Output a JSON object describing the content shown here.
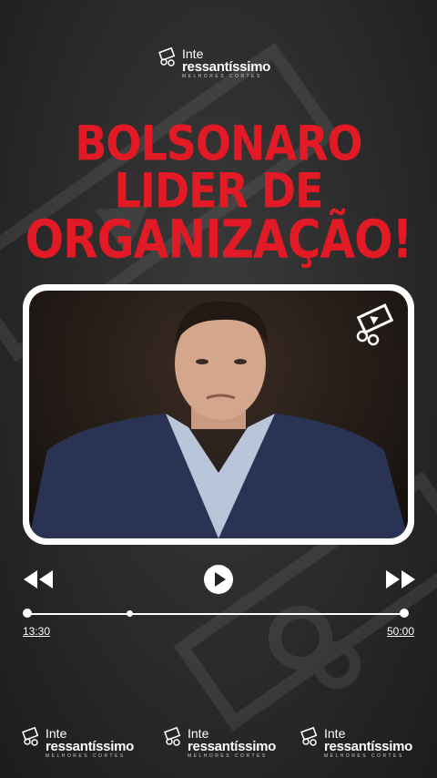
{
  "brand": {
    "line1": "Inte",
    "line2": "ressantíssimo",
    "tagline": "MELHORES CORTES"
  },
  "headline": {
    "line1": "BOLSONARO",
    "line2": "LIDER DE",
    "line3": "ORGANIZAÇÃO!"
  },
  "player": {
    "current_time": "13:30",
    "total_time": "50:00",
    "progress": 0.27
  },
  "icons": {
    "rewind": "rewind-icon",
    "play": "play-icon",
    "forward": "fast-forward-icon",
    "logo": "film-scissors-icon"
  },
  "colors": {
    "headline": "#e11a25",
    "frame": "#ffffff",
    "background": "#2a2a2a"
  }
}
